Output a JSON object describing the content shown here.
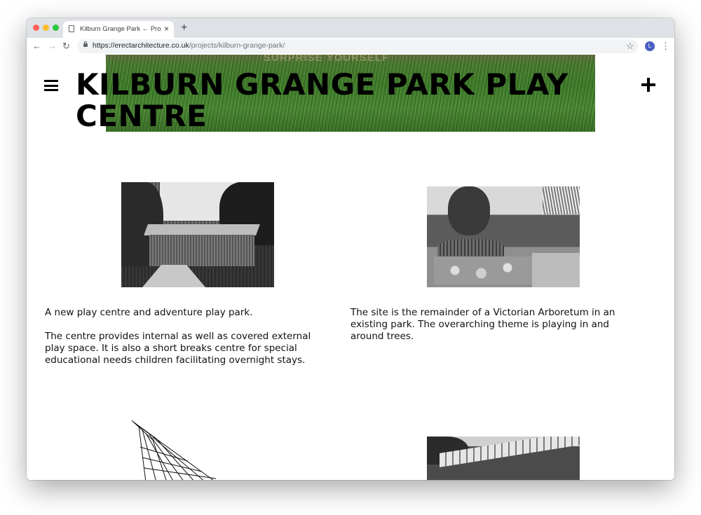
{
  "browser": {
    "tab_title": "Kilburn Grange Park ← Projects",
    "tab_close": "×",
    "new_tab": "+",
    "url_host": "https://erectarchitecture.co.uk",
    "url_path": "/projects/kilburn-grange-park/",
    "profile_initial": "L",
    "back_glyph": "←",
    "forward_glyph": "→",
    "reload_glyph": "↻",
    "star_glyph": "☆",
    "menu_glyph": "⋮"
  },
  "page": {
    "title": "KILBURN GRANGE PARK PLAY CENTRE",
    "hero_overlay": "SURPRISE YOURSELF",
    "left_column": {
      "paragraph_1": "A new play centre and adventure play park.",
      "paragraph_2": "The centre provides internal as well as covered external play space. It is also a short breaks centre for special educational needs children facilitating overnight stays."
    },
    "right_column": {
      "paragraph_1": "The site is the remainder of a Victorian Arboretum in an existing park. The overarching theme is playing in and around trees."
    }
  },
  "icons": {
    "nav_menu": "hamburger-menu-icon",
    "expand": "plus-icon",
    "page": "page-icon",
    "lock": "lock-icon"
  },
  "colors": {
    "tab_bar": "#dee1e6",
    "text": "#000000",
    "avatar": "#4a5fc1"
  }
}
